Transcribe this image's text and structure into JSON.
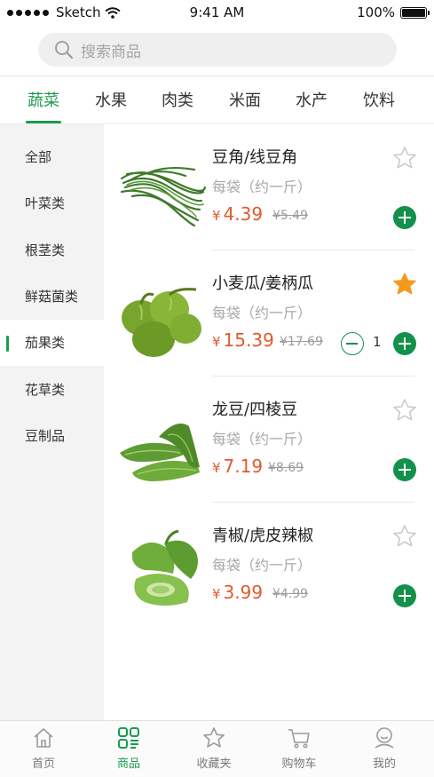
{
  "status_bar": {
    "carrier": "Sketch",
    "time": "9:41 AM",
    "battery": "100%"
  },
  "search": {
    "placeholder": "搜索商品"
  },
  "tabs": [
    {
      "label": "蔬菜",
      "active": true
    },
    {
      "label": "水果"
    },
    {
      "label": "肉类"
    },
    {
      "label": "米面"
    },
    {
      "label": "水产"
    },
    {
      "label": "饮料"
    }
  ],
  "sidebar": {
    "items": [
      {
        "label": "全部"
      },
      {
        "label": "叶菜类"
      },
      {
        "label": "根茎类"
      },
      {
        "label": "鲜菇菌类"
      },
      {
        "label": "茄果类",
        "active": true
      },
      {
        "label": "花草类"
      },
      {
        "label": "豆制品"
      }
    ]
  },
  "currency_symbol": "¥",
  "products": [
    {
      "name": "豆角/线豆角",
      "unit": "每袋（约一斤）",
      "price": "4.39",
      "original_price": "¥5.49",
      "favorited": false,
      "quantity": null
    },
    {
      "name": "小麦瓜/姜柄瓜",
      "unit": "每袋（约一斤）",
      "price": "15.39",
      "original_price": "¥17.69",
      "favorited": true,
      "quantity": "1"
    },
    {
      "name": "龙豆/四棱豆",
      "unit": "每袋（约一斤）",
      "price": "7.19",
      "original_price": "¥8.69",
      "favorited": false,
      "quantity": null
    },
    {
      "name": "青椒/虎皮辣椒",
      "unit": "每袋（约一斤）",
      "price": "3.99",
      "original_price": "¥4.99",
      "favorited": false,
      "quantity": null
    }
  ],
  "bottom_nav": [
    {
      "label": "首页",
      "icon": "home-icon"
    },
    {
      "label": "商品",
      "icon": "grid-icon",
      "active": true
    },
    {
      "label": "收藏夹",
      "icon": "star-icon"
    },
    {
      "label": "购物车",
      "icon": "cart-icon"
    },
    {
      "label": "我的",
      "icon": "profile-icon"
    }
  ],
  "colors": {
    "accent": "#1a9a4e",
    "price": "#e05a2b",
    "favorite": "#f39a1e",
    "sidebar_bg": "#f3f3f3"
  }
}
